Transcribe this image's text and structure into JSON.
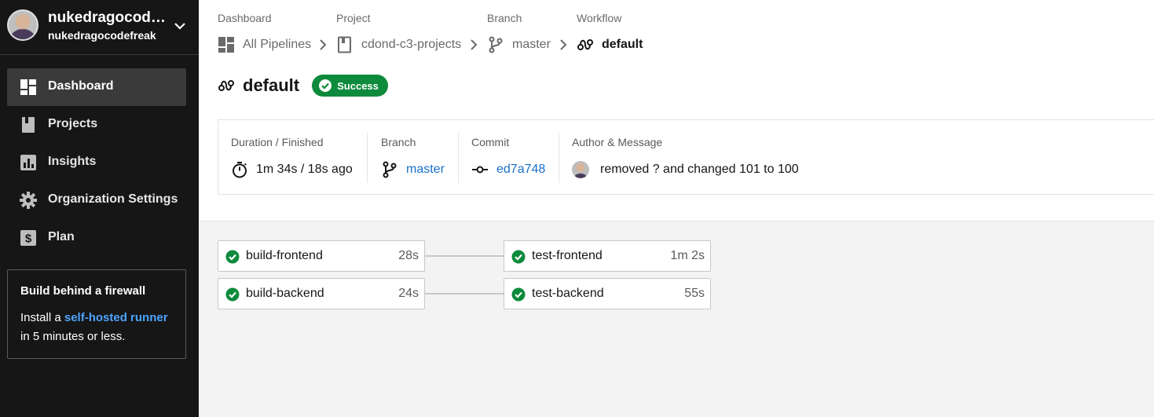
{
  "user": {
    "name": "nukedragocodefreak",
    "handle": "nukedragocodefreak"
  },
  "nav": [
    {
      "label": "Dashboard",
      "icon": "dashboard-icon",
      "active": true
    },
    {
      "label": "Projects",
      "icon": "projects-icon"
    },
    {
      "label": "Insights",
      "icon": "insights-icon"
    },
    {
      "label": "Organization Settings",
      "icon": "gear-icon"
    },
    {
      "label": "Plan",
      "icon": "dollar-icon"
    }
  ],
  "promo": {
    "heading": "Build behind a firewall",
    "text_before": "Install a ",
    "link": "self-hosted runner",
    "text_after": "in 5 minutes or less."
  },
  "breadcrumb": [
    {
      "label": "Dashboard",
      "value": "All Pipelines"
    },
    {
      "label": "Project",
      "value": "cdond-c3-projects"
    },
    {
      "label": "Branch",
      "value": "master"
    },
    {
      "label": "Workflow",
      "value": "default"
    }
  ],
  "workflow": {
    "name": "default",
    "status": "Success"
  },
  "summary": {
    "duration_label": "Duration / Finished",
    "duration_value": "1m 34s / 18s ago",
    "branch_label": "Branch",
    "branch_value": "master",
    "commit_label": "Commit",
    "commit_value": "ed7a748",
    "author_label": "Author & Message",
    "message": "removed ? and changed 101 to 100"
  },
  "jobs": [
    {
      "name": "build-frontend",
      "duration": "28s",
      "status": "success"
    },
    {
      "name": "test-frontend",
      "duration": "1m 2s",
      "status": "success"
    },
    {
      "name": "build-backend",
      "duration": "24s",
      "status": "success"
    },
    {
      "name": "test-backend",
      "duration": "55s",
      "status": "success"
    }
  ],
  "colors": {
    "success": "#0d8a3b",
    "link": "#1a6fc9",
    "sidebar": "#161616"
  }
}
